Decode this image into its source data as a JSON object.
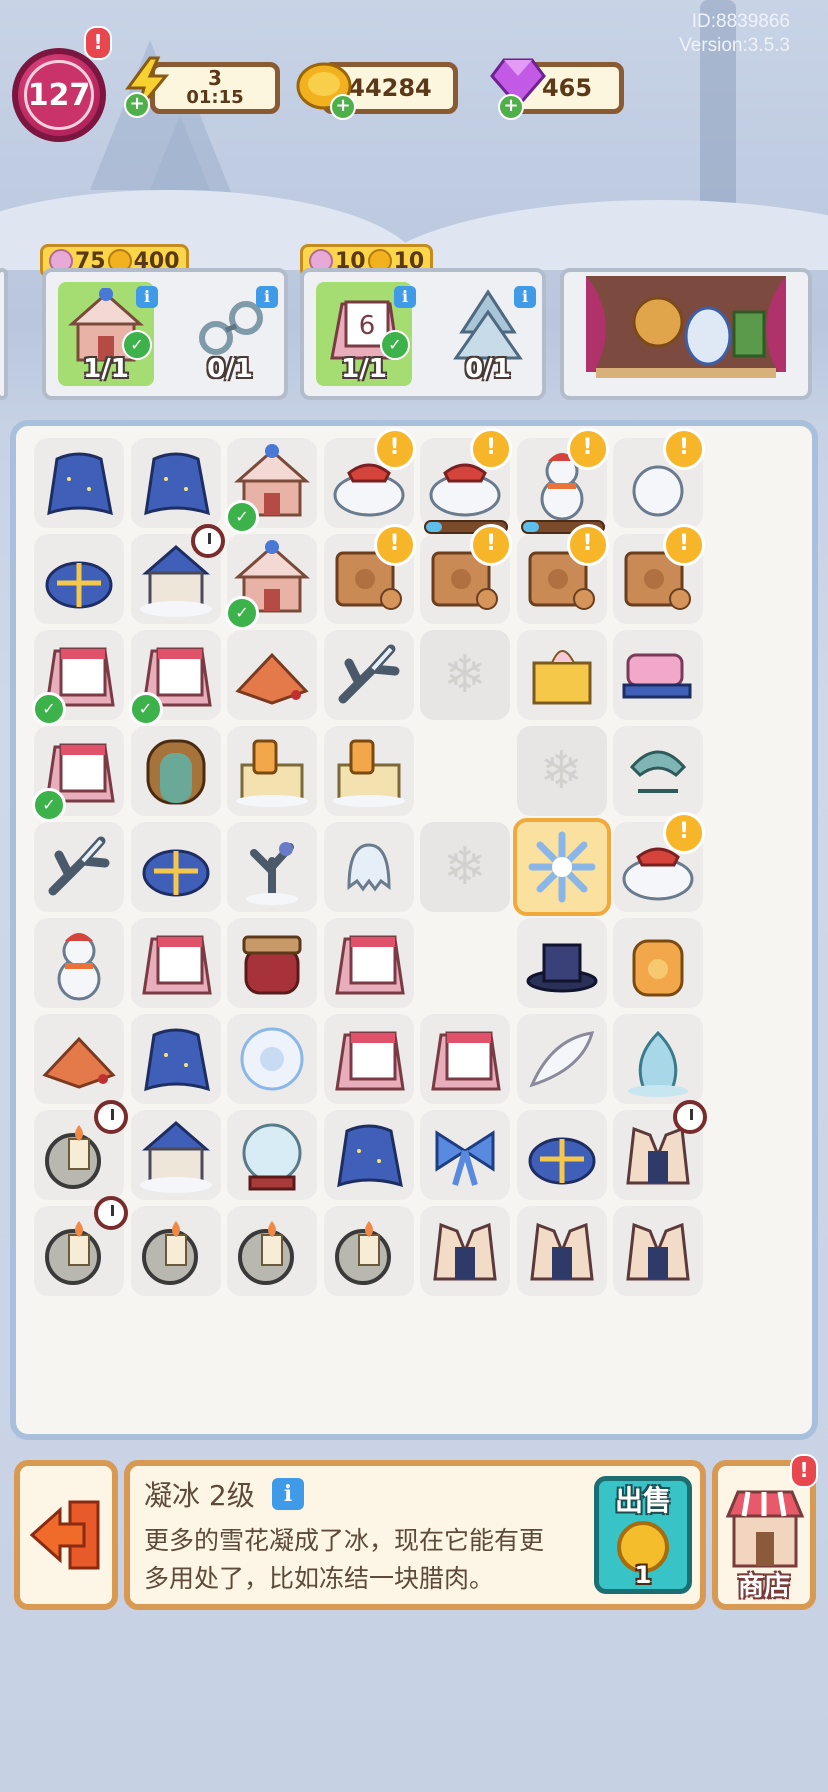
{
  "meta": {
    "id_text": "ID:8839866",
    "version_text": "Version:3.5.3"
  },
  "hud": {
    "level": "127",
    "energy": {
      "value": "3",
      "timer": "01:15"
    },
    "coins": "44284",
    "gems": "465"
  },
  "orders": [
    {
      "cost_a": "75",
      "cost_b": "400",
      "items": [
        {
          "count": "1/1",
          "done": true,
          "icon": "gingerbread-house-icon"
        },
        {
          "count": "0/1",
          "done": false,
          "icon": "handcuffs-icon"
        }
      ]
    },
    {
      "cost_a": "10",
      "cost_b": "10",
      "items": [
        {
          "count": "1/1",
          "done": true,
          "icon": "calendar-icon"
        },
        {
          "count": "0/1",
          "done": false,
          "icon": "snowy-tree-icon"
        }
      ]
    }
  ],
  "board": {
    "rows": [
      [
        "starry-cape-icon",
        "starry-cape-icon",
        "gingerbread-house-icon",
        "snow-pile-icon",
        "snow-pile-icon",
        "snowman-icon",
        "snowball-icon"
      ],
      [
        "blue-scarf-roll-icon",
        "snowy-mansion-icon",
        "gingerbread-house-icon",
        "cookie-sheet-icon",
        "cookie-sheet-icon",
        "cookie-sheet-icon",
        "cookie-sheet-icon"
      ],
      [
        "calendar-icon",
        "calendar-icon",
        "orange-blanket-icon",
        "frosted-branch-icon",
        "",
        "tissue-box-icon",
        "sewing-machine-icon"
      ],
      [
        "calendar-icon",
        "wooden-door-icon",
        "honey-jar-box-icon",
        "honey-jar-box-icon",
        "",
        "",
        "telephone-icon"
      ],
      [
        "frosted-branch-icon",
        "blue-scarf-roll-icon",
        "snowy-tree-bird-icon",
        "ice-ghost-icon",
        "",
        "frost-crystal-icon",
        "snow-pile-icon"
      ],
      [
        "snowman-icon",
        "calendar-icon",
        "jam-jar-icon",
        "calendar-icon",
        "",
        "top-hat-icon",
        "honey-jar-icon"
      ],
      [
        "orange-blanket-icon",
        "starry-cape-icon",
        "snowflake-lace-icon",
        "calendar-icon",
        "calendar-icon",
        "feather-icon",
        "ice-cobra-icon"
      ],
      [
        "candle-holder-icon",
        "snowy-mansion-icon",
        "polar-bear-globe-icon",
        "starry-cape-icon",
        "blue-bow-icon",
        "blue-scarf-roll-icon",
        "fancy-vest-icon"
      ],
      [
        "candle-holder-icon",
        "candle-holder-icon",
        "candle-holder-icon",
        "candle-holder-icon",
        "fancy-vest-icon",
        "fancy-vest-icon",
        "fancy-vest-icon"
      ]
    ]
  },
  "selected_item": {
    "title": "凝冰 2级",
    "description": "更多的雪花凝成了冰，现在它能有更多用处了，比如冻结一块腊肉。",
    "sell_label": "出售",
    "sell_price": "1"
  },
  "shop_label": "商店",
  "colors": {
    "board_border": "#a9c0dc",
    "panel_border": "#d89a53",
    "sell_bg": "#38c3c6",
    "coin": "#f2b21f",
    "gem": "#b34fd8"
  }
}
